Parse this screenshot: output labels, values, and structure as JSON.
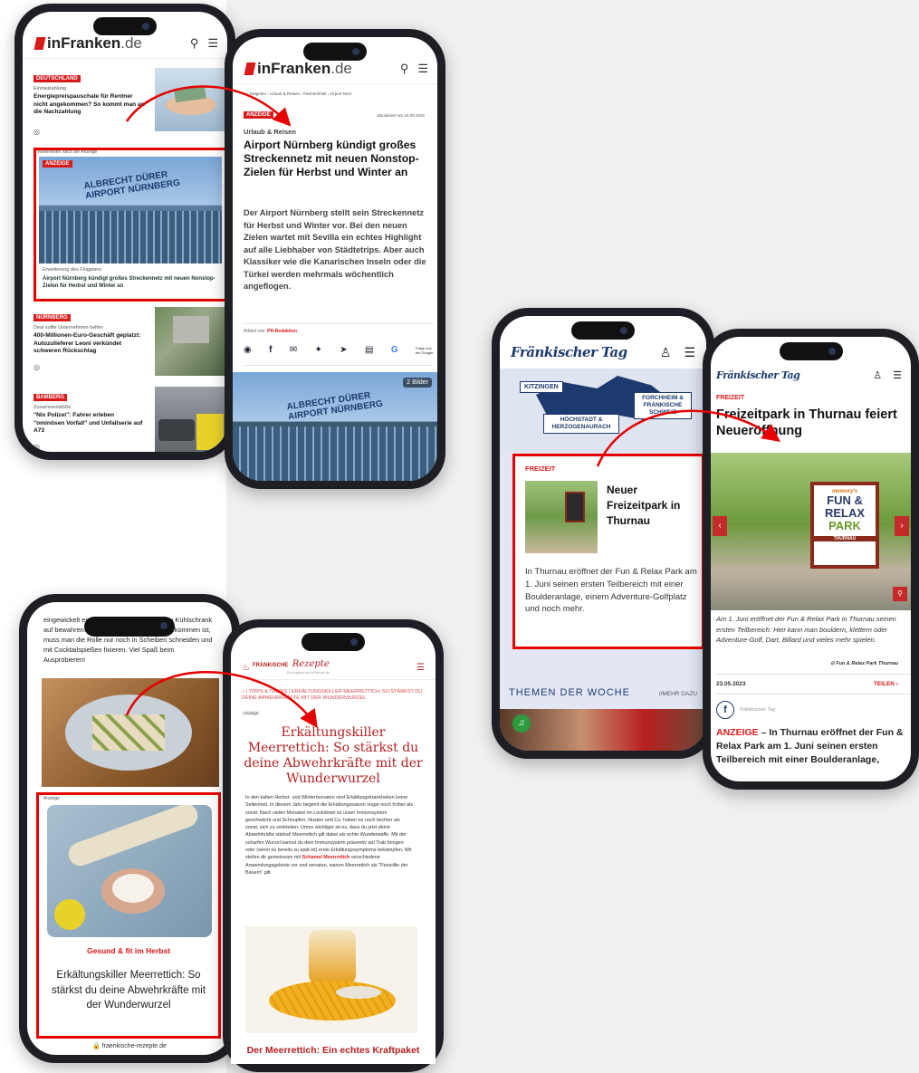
{
  "p1": {
    "logo_main": "inFranken",
    "logo_suffix": ".de",
    "a1_tag": "DEUTSCHLAND",
    "a1_kicker": "Einmalzahlung",
    "a1_title": "Energiepreispauschale für Rentner nicht angekommen? So kommt man an die Nachzahlung",
    "ad_note": "Weiterlesen nach der Anzeige",
    "ad_tag": "ANZEIGE",
    "sign_l1": "ALBRECHT DÜRER",
    "sign_l2": "AIRPORT NÜRNBERG",
    "ad_kicker": "Erweiterung des Flugplans",
    "ad_title": "Airport Nürnberg kündigt großes Streckennetz mit neuen Nonstop-Zielen für Herbst und Winter an",
    "a2_tag": "NÜRNBERG",
    "a2_kicker": "Deal sollte Unternehmen helfen",
    "a2_title": "400-Millionen-Euro-Geschäft geplatzt: Autozulieferer Leoni verkündet schweren Rückschlag",
    "a3_tag": "BAMBERG",
    "a3_kicker": "Zusammenstöße",
    "a3_title": "\"Nix Polizei\": Fahrer erleben \"ominösen Vorfall\" und Unfallserie auf A73"
  },
  "p2": {
    "logo_main": "inFranken",
    "logo_suffix": ".de",
    "breadcrumb": "⌂  ›  Ratgeber  ›  Urlaub & Reisen  ›  Partnerinhalt  ›  Airport Nürn",
    "tag": "ANZEIGE",
    "updated": "aktualisiert am 18.09.2022",
    "kicker": "Urlaub & Reisen",
    "title": "Airport Nürnberg kündigt großes Streckennetz mit neuen Nonstop-Zielen für Herbst und Winter an",
    "lead": "Der Airport Nürnberg stellt sein Streckennetz für Herbst und Winter vor. Bei den neuen Zielen wartet mit Sevilla ein echtes Highlight auf alle Liebhaber von Städtetrips. Aber auch Klassiker wie die Kanarischen Inseln oder die Türkei werden mehrmals wöchentlich angeflogen.",
    "author_label": "Artikel von:",
    "author": "PR-Redaktion",
    "share_google": "Folge uns bei Google",
    "gallery_count": "2 Bilder",
    "sign_l1": "ALBRECHT DÜRER",
    "sign_l2": "AIRPORT NÜRNBERG"
  },
  "p3": {
    "logo": "Fränkischer Tag",
    "region_1": "KITZINGEN",
    "region_2": "FORCHHEIM & FRÄNKISCHE SCHWEIZ",
    "region_3": "HÖCHSTADT & HERZOGENAURACH",
    "tag": "FREIZEIT",
    "title": "Neuer Freizeitpark in Thurnau",
    "text": "In Thurnau eröffnet der Fun & Relax Park am 1. Juni seinen ersten Teilbereich mit einer Boulderanlage, einem Adventure-Golfplatz und noch mehr.",
    "themen": "THEMEN DER WOCHE",
    "mehr": "//MEHR DAZU"
  },
  "p4": {
    "logo": "Fränkischer Tag",
    "tag": "FREIZEIT",
    "title": "Freizeitpark in Thurnau feiert Neueröffnung",
    "sign_top": "memory's",
    "sign_l1": "FUN &",
    "sign_l2": "RELAX",
    "sign_l3": "PARK",
    "sign_l4": "THURNAU",
    "caption": "Am 1. Juni eröffnet der Fun & Relax Park in Thurnau seinen ersten Teilbereich: Hier kann man bouldern, klettern oder Adventure-Golf, Dart, Billard und vieles mehr spielen.",
    "credit": "Fun & Relax Park Thurnau",
    "date": "23.05.2023",
    "share": "TEILEN",
    "author": "Fränkischer Tag",
    "ad_label": "ANZEIGE",
    "lead": "– In Thurnau eröffnet der Fun & Relax Park am 1. Juni seinen ersten Teilbereich mit einer Boulderanlage,"
  },
  "p5": {
    "text": "eingewickelt eine Stunde lang fest schon im Kühlschrank auf bewahren. Wenn der große Tag dann gekommen ist, muss man die Rolle nur noch in Scheiben schneiden und mit Cocktailspießen fixieren. Viel Spaß beim Ausprobieren!",
    "ad_label": "Anzeige",
    "kicker": "Gesund & fit im Herbst",
    "title": "Erkältungskiller Meerrettich: So stärkst du deine Abwehrkräfte mit der Wunderwurzel",
    "url": "fraenkische-rezepte.de"
  },
  "p6": {
    "logo_main": "FRÄNKISCHE",
    "logo_script": "Rezepte",
    "logo_sub": "Ein Angebot von inFranken.de",
    "breadcrumb": "TIPPS & TRICKS | ERKÄLTUNGSKILLER MEERRETTICH: SO STÄRKST DU DEINE ABWEHRKRÄFTE MIT DER WUNDERWURZEL",
    "ad_label": "Anzeige",
    "title": "Erkältungskiller Meerrettich: So stärkst du deine Abwehrkräfte mit der Wunderwurzel",
    "body_1": "In den kalten Herbst- und Wintermonaten sind Erkältungskrankheiten keine Seltenheit. In diesem Jahr beginnt die Erkältungssaison sogar noch früher als sonst: Nach vielen Monaten im Lockdown ist unser Immunsystem geschwächt und Schnupfen, Husten und Co. haben es noch leichter als sonst, sich zu verbreiten. Umso wichtiger ist es, dass du jetzt deine Abwehrkräfte stärkst! Meerrettich gilt dabei als echte Wunderwaffe. Mit der scharfen Wurzel kannst du dein Immunsystem präventiv auf Trab bringen oder (wenn es bereits zu spät ist) erste Erkältungssymptome bekämpfen. Wir stellen dir gemeinsam mit",
    "body_link": "Schamel Meerrettich",
    "body_2": "verschiedene Anwendungsgebiete vor und verraten, warum Meerrettich als \"Penicillin der Bauern\" gilt.",
    "subhead": "Der Meerrettich: Ein echtes Kraftpaket"
  },
  "colors": {
    "red": "#d91a1a",
    "highlight": "#e60000",
    "navy": "#1c3a6e",
    "rezepte_red": "#b41f1f"
  }
}
